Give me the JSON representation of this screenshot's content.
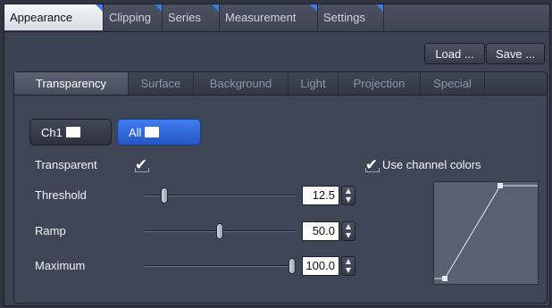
{
  "top_tabs": [
    {
      "label": "Appearance",
      "active": true
    },
    {
      "label": "Clipping",
      "active": false
    },
    {
      "label": "Series",
      "active": false
    },
    {
      "label": "Measurement",
      "active": false
    },
    {
      "label": "Settings",
      "active": false
    }
  ],
  "toolbar": {
    "load_label": "Load ...",
    "save_label": "Save ..."
  },
  "sub_tabs": [
    {
      "label": "Transparency",
      "active": true
    },
    {
      "label": "Surface",
      "active": false
    },
    {
      "label": "Background",
      "active": false
    },
    {
      "label": "Light",
      "active": false
    },
    {
      "label": "Projection",
      "active": false
    },
    {
      "label": "Special",
      "active": false
    }
  ],
  "channels": [
    {
      "label": "Ch1",
      "selected": false,
      "swatch_color": "#ffffff"
    },
    {
      "label": "All",
      "selected": true,
      "swatch_color": "#ffffff"
    }
  ],
  "options": {
    "transparent_label": "Transparent",
    "transparent_checked": true,
    "use_channel_colors_label": "Use channel colors",
    "use_channel_colors_checked": true
  },
  "sliders": [
    {
      "label": "Threshold",
      "value": "12.5",
      "fraction": 0.12
    },
    {
      "label": "Ramp",
      "value": "50.0",
      "fraction": 0.5
    },
    {
      "label": "Maximum",
      "value": "100.0",
      "fraction": 1.0
    }
  ],
  "colors": {
    "accent": "#3a7cf0",
    "selected_button": "#2f66d8",
    "panel": "#3e4554"
  }
}
